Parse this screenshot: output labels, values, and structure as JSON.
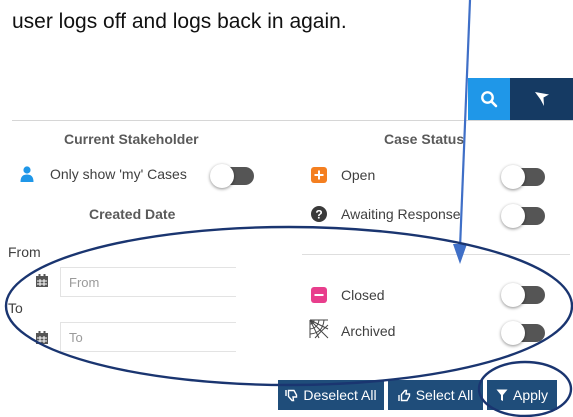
{
  "caption": "user logs off and logs back in again.",
  "toolbar": {
    "search_icon": "search-icon",
    "filter_icon": "filter-icon"
  },
  "stakeholder": {
    "header": "Current Stakeholder",
    "only_mine_label": "Only show 'my' Cases",
    "only_mine_on": false
  },
  "created_date": {
    "header": "Created Date",
    "from_label": "From",
    "from_placeholder": "From",
    "to_label": "To",
    "to_placeholder": "To"
  },
  "case_status": {
    "header": "Case Status",
    "items": [
      {
        "label": "Open",
        "icon": "plus-square-icon",
        "color": "#f47f20",
        "on": false
      },
      {
        "label": "Awaiting Response",
        "icon": "question-circle-icon",
        "color": "#3a3a3a",
        "on": false
      },
      {
        "label": "Closed",
        "icon": "minus-square-icon",
        "color": "#e83e8c",
        "on": false
      },
      {
        "label": "Archived",
        "icon": "cobweb-icon",
        "color": "#444444",
        "on": false
      }
    ]
  },
  "actions": {
    "deselect_all": "Deselect All",
    "select_all": "Select All",
    "apply": "Apply"
  },
  "colors": {
    "annotation": "#1a3570",
    "arrow": "#3f6fc7",
    "button_dark": "#1f4d7a",
    "search_blue": "#1f97e8"
  }
}
